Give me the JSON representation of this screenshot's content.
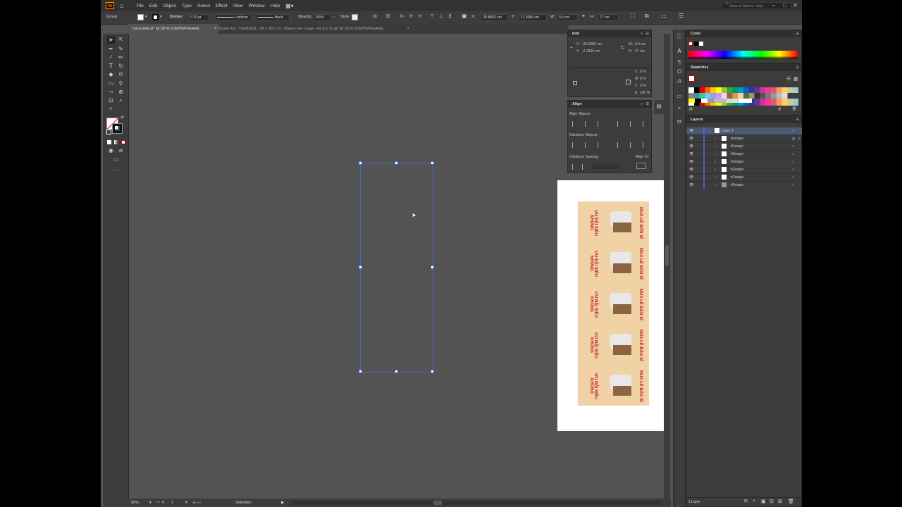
{
  "app": {
    "logo": "Ai"
  },
  "menu": [
    "File",
    "Edit",
    "Object",
    "Type",
    "Select",
    "Effect",
    "View",
    "Window",
    "Help"
  ],
  "search": {
    "placeholder": "Search Adobe Help"
  },
  "control": {
    "selection_label": "Group",
    "stroke_label": "Stroke:",
    "stroke_weight": "0.25 pt",
    "profile": "Uniform",
    "brush": "Basic",
    "opacity_label": "Opacity:",
    "opacity": "100%",
    "style_label": "Style:",
    "x_label": "X:",
    "x": "-20.8682 cm",
    "y_label": "Y:",
    "y": "11.2686 cm",
    "w_label": "W:",
    "w": "9.4 cm",
    "h_label": "H:",
    "h": "27 cm"
  },
  "tabs": [
    {
      "label": "Torroi-9x6.ai* @ 50 % (CMYK/Preview)",
      "active": true
    },
    {
      "label": "Khuon hoi - TG203011 - 20 x 30 x 11 - Khuon noi - Laze - 42.5 x 31.ai* @ 25 % (CMYK/Preview)",
      "active": false
    }
  ],
  "status": {
    "zoom": "50%",
    "artboard": "1",
    "tool": "Selection"
  },
  "info": {
    "title": "Info",
    "x_label": "X:",
    "x": "-25.5682 cm",
    "y_label": "Y:",
    "y": "-2.2304 cm",
    "w_label": "W:",
    "w": "9.4 cm",
    "h_label": "H:",
    "h": "27 cm",
    "c_label": "C:",
    "c": "0 %",
    "m_label": "M:",
    "m": "0 %",
    "yv_label": "Y:",
    "yv": "0 %",
    "k_label": "K:",
    "k": "100 %"
  },
  "align": {
    "title": "Align",
    "align_objects": "Align Objects:",
    "distribute_objects": "Distribute Objects:",
    "distribute_spacing": "Distribute Spacing:",
    "align_to": "Align To:"
  },
  "color_panel": {
    "title": "Color"
  },
  "swatches_panel": {
    "title": "Swatches"
  },
  "layers_panel": {
    "title": "Layers",
    "layer_name": "Layer 1",
    "groups": [
      "<Group>",
      "<Group>",
      "<Group>",
      "<Group>",
      "<Group>",
      "<Group>",
      "<Group>"
    ],
    "footer": "1 Layer"
  },
  "artwork": {
    "card_text_left": "ƯU ĐÃI SIÊU KHỦNG",
    "card_text_right": "MUA LẺ BÁN SỈ"
  },
  "colors": {
    "app_bg": "#535353",
    "panel_bg": "#3c3c3c",
    "selection_blue": "#4a66d6",
    "brand_orange": "#ff9a00",
    "card_red": "#c0202e",
    "card_tan": "#f0d2a4"
  }
}
